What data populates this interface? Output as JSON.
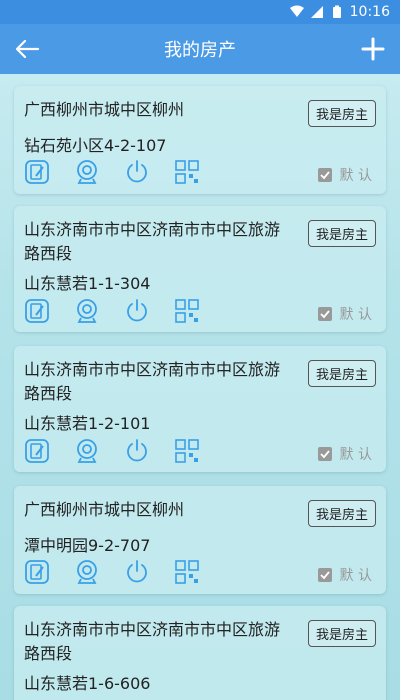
{
  "status_bar": {
    "time": "10:16"
  },
  "header": {
    "title": "我的房产"
  },
  "properties": [
    {
      "address": "广西柳州市城中区柳州",
      "estate": "钻石苑小区4-2-107",
      "owner_label": "我是房主",
      "default_label": "默 认"
    },
    {
      "address": "山东济南市市中区济南市市中区旅游路西段",
      "estate": "山东慧若1-1-304",
      "owner_label": "我是房主",
      "default_label": "默 认"
    },
    {
      "address": "山东济南市市中区济南市市中区旅游路西段",
      "estate": "山东慧若1-2-101",
      "owner_label": "我是房主",
      "default_label": "默 认"
    },
    {
      "address": "广西柳州市城中区柳州",
      "estate": "潭中明园9-2-707",
      "owner_label": "我是房主",
      "default_label": "默 认"
    },
    {
      "address": "山东济南市市中区济南市市中区旅游路西段",
      "estate": "山东慧若1-6-606",
      "owner_label": "我是房主",
      "default_label": ""
    }
  ],
  "colors": {
    "accent": "#4a9ae6",
    "icon": "#3aa0e6"
  },
  "icon_names": [
    "edit-icon",
    "camera-icon",
    "power-icon",
    "qrcode-icon"
  ]
}
